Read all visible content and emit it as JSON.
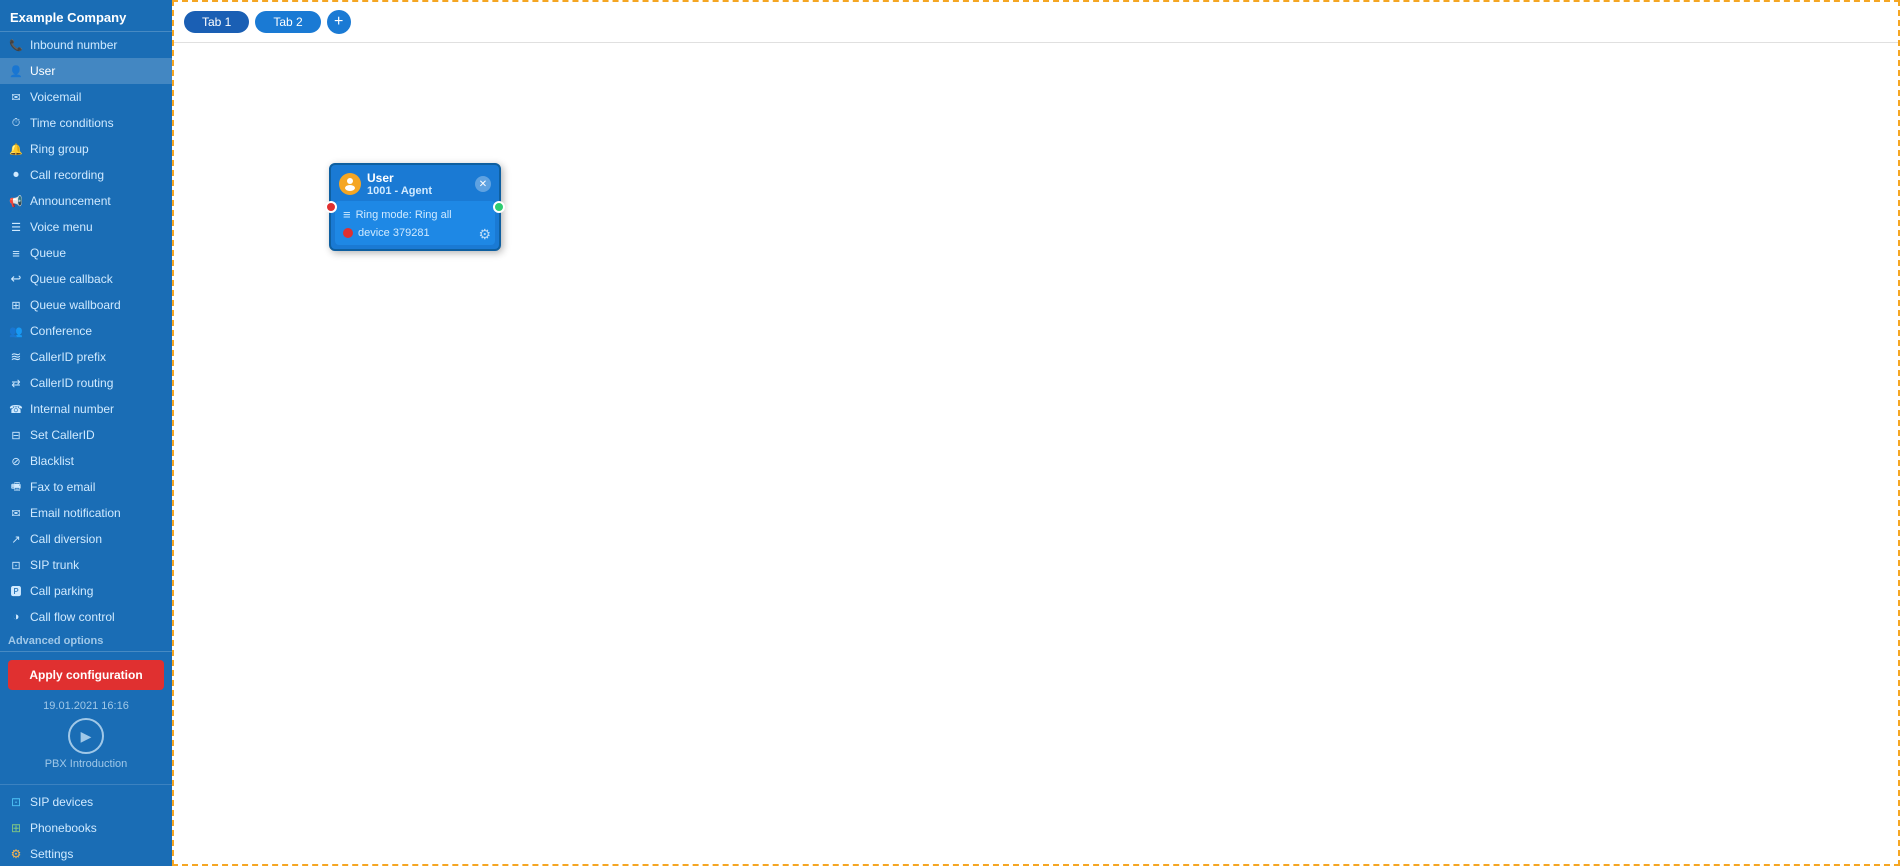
{
  "company": "Example Company",
  "sidebar": {
    "items": [
      {
        "id": "inbound-number",
        "label": "Inbound number",
        "icon": "phone",
        "active": false
      },
      {
        "id": "user",
        "label": "User",
        "icon": "user",
        "active": true
      },
      {
        "id": "voicemail",
        "label": "Voicemail",
        "icon": "voicemail",
        "active": false
      },
      {
        "id": "time-conditions",
        "label": "Time conditions",
        "icon": "time",
        "active": false
      },
      {
        "id": "ring-group",
        "label": "Ring group",
        "icon": "ring",
        "active": false
      },
      {
        "id": "call-recording",
        "label": "Call recording",
        "icon": "recording",
        "active": false
      },
      {
        "id": "announcement",
        "label": "Announcement",
        "icon": "announce",
        "active": false
      },
      {
        "id": "voice-menu",
        "label": "Voice menu",
        "icon": "menu",
        "active": false
      },
      {
        "id": "queue",
        "label": "Queue",
        "icon": "queue",
        "active": false
      },
      {
        "id": "queue-callback",
        "label": "Queue callback",
        "icon": "callback",
        "active": false
      },
      {
        "id": "queue-wallboard",
        "label": "Queue wallboard",
        "icon": "wallboard",
        "active": false
      },
      {
        "id": "conference",
        "label": "Conference",
        "icon": "conference",
        "active": false
      },
      {
        "id": "callerid-prefix",
        "label": "CallerID prefix",
        "icon": "callerid",
        "active": false
      },
      {
        "id": "callerid-routing",
        "label": "CallerID routing",
        "icon": "routing",
        "active": false
      },
      {
        "id": "internal-number",
        "label": "Internal number",
        "icon": "internal",
        "active": false
      },
      {
        "id": "set-callerid",
        "label": "Set CallerID",
        "icon": "setcid",
        "active": false
      },
      {
        "id": "blacklist",
        "label": "Blacklist",
        "icon": "blacklist",
        "active": false
      },
      {
        "id": "fax-to-email",
        "label": "Fax to email",
        "icon": "fax",
        "active": false
      },
      {
        "id": "email-notification",
        "label": "Email notification",
        "icon": "email",
        "active": false
      },
      {
        "id": "call-diversion",
        "label": "Call diversion",
        "icon": "divert",
        "active": false
      },
      {
        "id": "sip-trunk",
        "label": "SIP trunk",
        "icon": "sip",
        "active": false
      },
      {
        "id": "call-parking",
        "label": "Call parking",
        "icon": "parking",
        "active": false
      },
      {
        "id": "call-flow-control",
        "label": "Call flow control",
        "icon": "flow",
        "active": false
      }
    ],
    "advanced_options": "Advanced options",
    "apply_button": "Apply configuration",
    "timestamp": "19.01.2021 16:16",
    "pbx_intro": "PBX Introduction",
    "bottom_items": [
      {
        "id": "sip-devices",
        "label": "SIP devices",
        "icon": "sipdev"
      },
      {
        "id": "phonebooks",
        "label": "Phonebooks",
        "icon": "phonebook"
      },
      {
        "id": "settings",
        "label": "Settings",
        "icon": "settings"
      }
    ]
  },
  "tabs": [
    {
      "id": "tab1",
      "label": "Tab 1",
      "active": true
    },
    {
      "id": "tab2",
      "label": "Tab 2",
      "active": false
    }
  ],
  "tab_add_label": "+",
  "node": {
    "title": "User",
    "subtitle": "1001 - Agent",
    "ring_mode_label": "Ring mode: Ring all",
    "device_label": "device 379281"
  }
}
